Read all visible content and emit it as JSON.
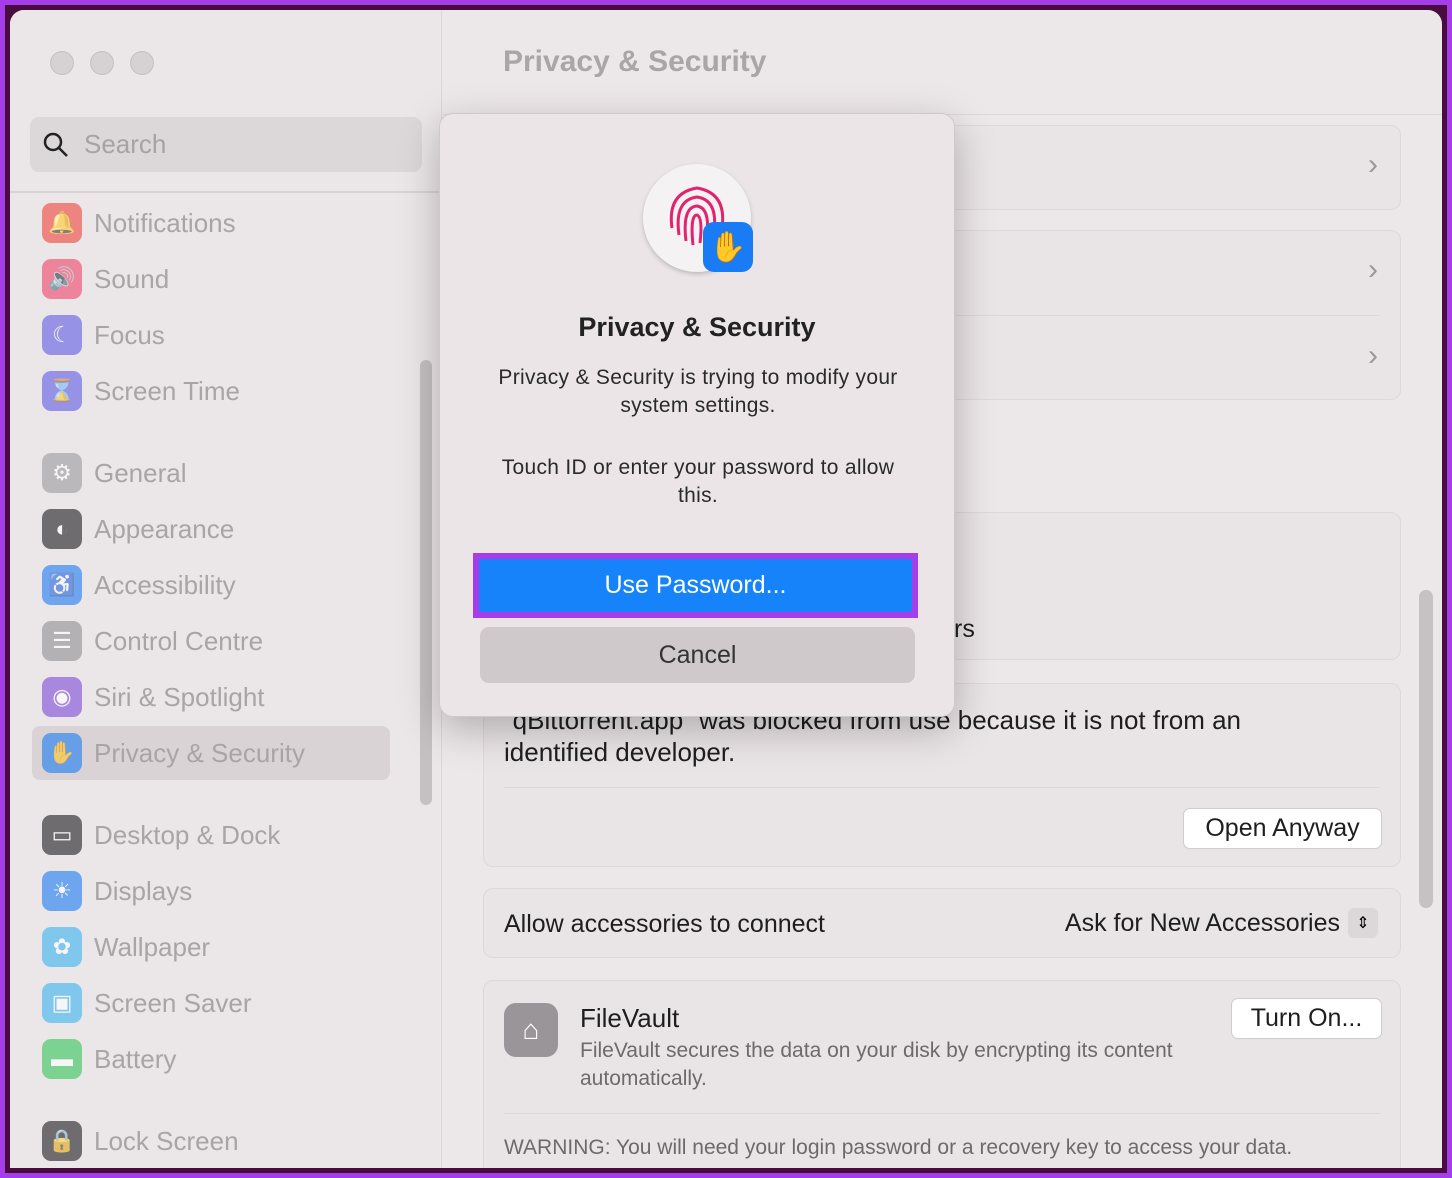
{
  "window": {
    "title": "Privacy & Security"
  },
  "search": {
    "placeholder": "Search"
  },
  "sidebar": {
    "items": [
      {
        "label": "Notifications",
        "icon": "bell-icon",
        "color": "#f0443a"
      },
      {
        "label": "Sound",
        "icon": "speaker-icon",
        "color": "#f0446a"
      },
      {
        "label": "Focus",
        "icon": "moon-icon",
        "color": "#5e5ce6"
      },
      {
        "label": "Screen Time",
        "icon": "hourglass-icon",
        "color": "#5e5ce6"
      },
      {
        "label": "General",
        "icon": "gear-icon",
        "color": "#9a9a9e"
      },
      {
        "label": "Appearance",
        "icon": "appearance-icon",
        "color": "#1c1c1e"
      },
      {
        "label": "Accessibility",
        "icon": "accessibility-icon",
        "color": "#1a7cf5"
      },
      {
        "label": "Control Centre",
        "icon": "toggles-icon",
        "color": "#8e8e93"
      },
      {
        "label": "Siri & Spotlight",
        "icon": "siri-icon",
        "color": "#7a4ad8"
      },
      {
        "label": "Privacy & Security",
        "icon": "hand-icon",
        "color": "#1a7cf5",
        "selected": true
      },
      {
        "label": "Desktop & Dock",
        "icon": "dock-icon",
        "color": "#1c1c1e"
      },
      {
        "label": "Displays",
        "icon": "sun-icon",
        "color": "#1a7cf5"
      },
      {
        "label": "Wallpaper",
        "icon": "flower-icon",
        "color": "#38b4f0"
      },
      {
        "label": "Screen Saver",
        "icon": "screensaver-icon",
        "color": "#38b4f0"
      },
      {
        "label": "Battery",
        "icon": "battery-icon",
        "color": "#34c759"
      },
      {
        "label": "Lock Screen",
        "icon": "lock-icon",
        "color": "#1c1c1e"
      }
    ]
  },
  "main": {
    "partial_text": "rs",
    "blocked_message": "“qBittorrent.app” was blocked from use because it is not from an identified developer.",
    "open_anyway": "Open Anyway",
    "accessories_label": "Allow accessories to connect",
    "accessories_value": "Ask for New Accessories",
    "filevault_title": "FileVault",
    "filevault_desc": "FileVault secures the data on your disk by encrypting its content automatically.",
    "filevault_button": "Turn On...",
    "warning": "WARNING: You will need your login password or a recovery key to access your data."
  },
  "dialog": {
    "title": "Privacy & Security",
    "message": "Privacy & Security is trying to modify your system settings.",
    "prompt": "Touch ID or enter your password to allow this.",
    "primary": "Use Password...",
    "cancel": "Cancel",
    "highlight_color": "#a43ee8"
  }
}
